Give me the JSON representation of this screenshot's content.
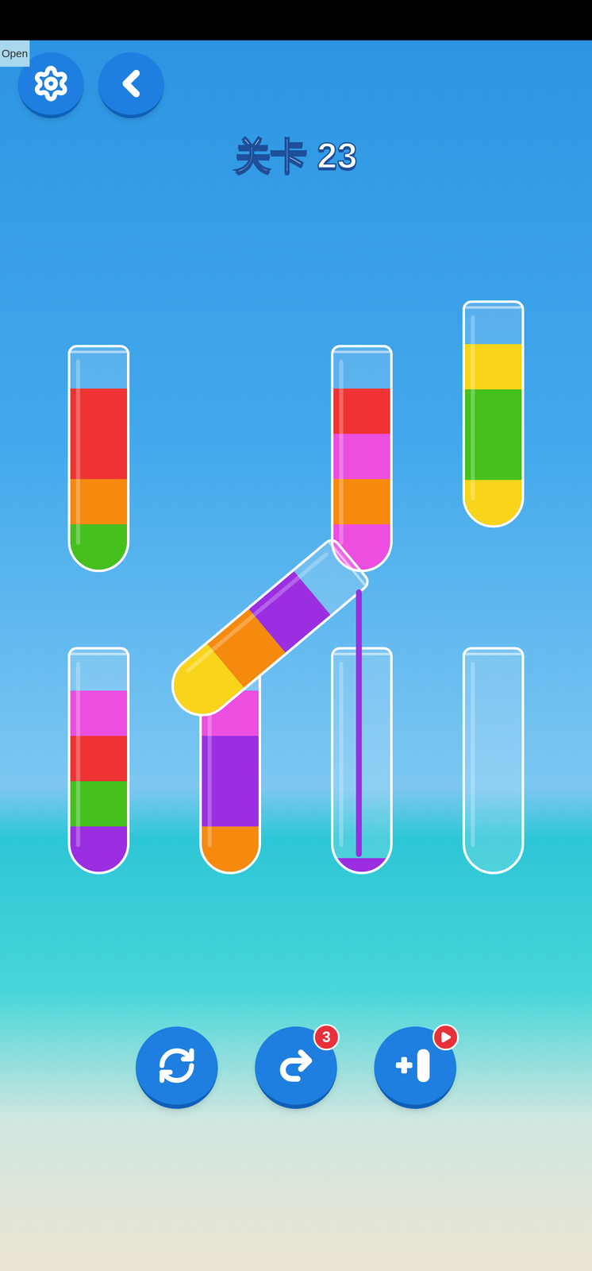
{
  "status_tag": "Open",
  "title": "关卡 23",
  "rows": [
    [
      {
        "lifted": false,
        "raised": false,
        "layers": [
          {
            "color": "#45c01e",
            "amount": 1
          },
          {
            "color": "#f58a0e",
            "amount": 1
          },
          {
            "color": "#ef3333",
            "amount": 2
          }
        ]
      },
      {
        "lifted": true,
        "raised": false,
        "layers": []
      },
      {
        "lifted": false,
        "raised": false,
        "layers": [
          {
            "color": "#ec4ee0",
            "amount": 1
          },
          {
            "color": "#f58a0e",
            "amount": 1
          },
          {
            "color": "#ec4ee0",
            "amount": 1
          },
          {
            "color": "#ef3333",
            "amount": 1
          }
        ]
      },
      {
        "lifted": false,
        "raised": true,
        "layers": [
          {
            "color": "#f8d41a",
            "amount": 1
          },
          {
            "color": "#45c01e",
            "amount": 2
          },
          {
            "color": "#f8d41a",
            "amount": 1
          }
        ]
      }
    ],
    [
      {
        "lifted": false,
        "raised": false,
        "layers": [
          {
            "color": "#9b2ee0",
            "amount": 1
          },
          {
            "color": "#45c01e",
            "amount": 1
          },
          {
            "color": "#ef3333",
            "amount": 1
          },
          {
            "color": "#ec4ee0",
            "amount": 1
          }
        ]
      },
      {
        "lifted": false,
        "raised": false,
        "layers": [
          {
            "color": "#f58a0e",
            "amount": 1
          },
          {
            "color": "#9b2ee0",
            "amount": 2
          },
          {
            "color": "#ec4ee0",
            "amount": 1
          }
        ]
      },
      {
        "lifted": false,
        "raised": false,
        "layers": [
          {
            "color": "#9b2ee0",
            "amount": 0.3
          }
        ]
      },
      {
        "lifted": false,
        "raised": false,
        "layers": []
      }
    ]
  ],
  "pouring_tube": {
    "pouring": true,
    "layers": [
      {
        "color": "#f8d41a",
        "amount": 1.3
      },
      {
        "color": "#f58a0e",
        "amount": 1.2
      },
      {
        "color": "#9b2ee0",
        "amount": 1.3
      }
    ]
  },
  "buttons": [
    {
      "kind": "restart",
      "badge": ""
    },
    {
      "kind": "undo",
      "badge": "3"
    },
    {
      "kind": "add-tube",
      "badge": ""
    }
  ]
}
